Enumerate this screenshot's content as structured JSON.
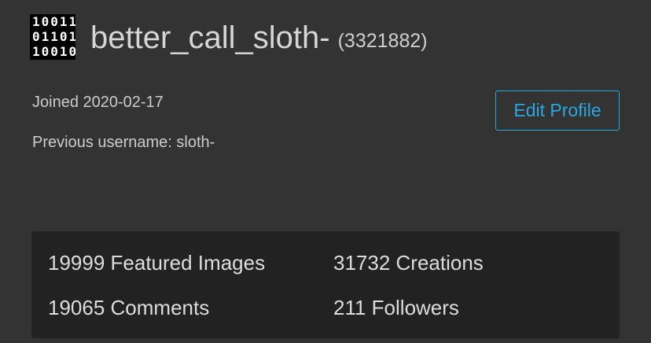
{
  "profile": {
    "avatar_rows": [
      "10011",
      "01101",
      "10010"
    ],
    "username": "better_call_sloth-",
    "user_id": "(3321882)",
    "joined": "Joined 2020-02-17",
    "previous_username": "Previous username: sloth-",
    "edit_label": "Edit Profile"
  },
  "stats": {
    "featured_images": "19999 Featured Images",
    "creations": "31732 Creations",
    "comments": "19065 Comments",
    "followers": "211 Followers"
  },
  "colors": {
    "background": "#333333",
    "stats_panel": "#222222",
    "accent": "#29a8df",
    "text": "#d8d8d8"
  }
}
